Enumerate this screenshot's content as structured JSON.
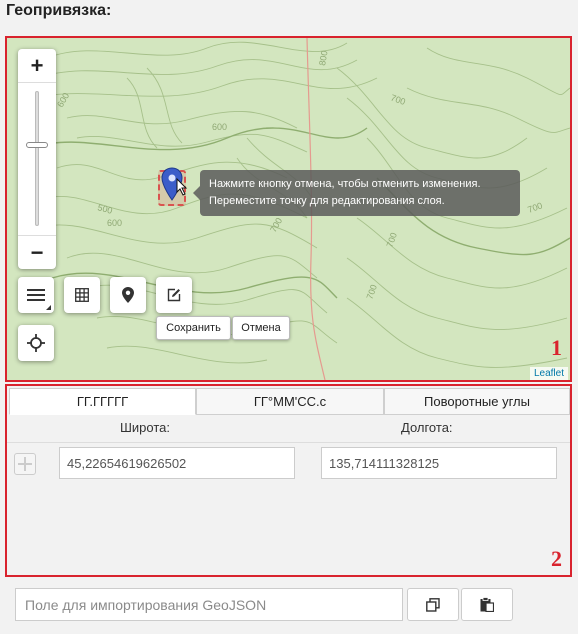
{
  "page": {
    "title": "Геопривязка:"
  },
  "map": {
    "zoom_in_label": "+",
    "zoom_out_label": "−",
    "zoom_level": 0.6,
    "tooltip_line1": "Нажмите кнопку отмена, чтобы отменить изменения.",
    "tooltip_line2": "Переместите точку для редактирования слоя.",
    "save_label": "Сохранить",
    "cancel_label": "Отмена",
    "attribution": "Leaflet",
    "contour_labels": [
      "600",
      "700",
      "600",
      "500",
      "600",
      "800",
      "700",
      "700",
      "700",
      "700"
    ],
    "tools": [
      "layers-icon",
      "grid-icon",
      "map-marker-icon",
      "edit-icon",
      "locate-icon"
    ],
    "annotation_number": "1"
  },
  "coords": {
    "tabs": [
      {
        "label": "ГГ.ГГГГГ",
        "active": true
      },
      {
        "label": "ГГ°ММ'СС.с",
        "active": false
      },
      {
        "label": "Поворотные углы",
        "active": false
      }
    ],
    "latitude_label": "Широта:",
    "longitude_label": "Долгота:",
    "latitude_value": "45,22654619626502",
    "longitude_value": "135,714111328125",
    "annotation_number": "2"
  },
  "import": {
    "placeholder": "Поле для импортирования GeoJSON"
  },
  "colors": {
    "frame": "#d9232e",
    "map_bg": "#d6e8c3",
    "contour": "#9cb77e",
    "marker": "#3b5dc9",
    "link": "#0078a8"
  }
}
